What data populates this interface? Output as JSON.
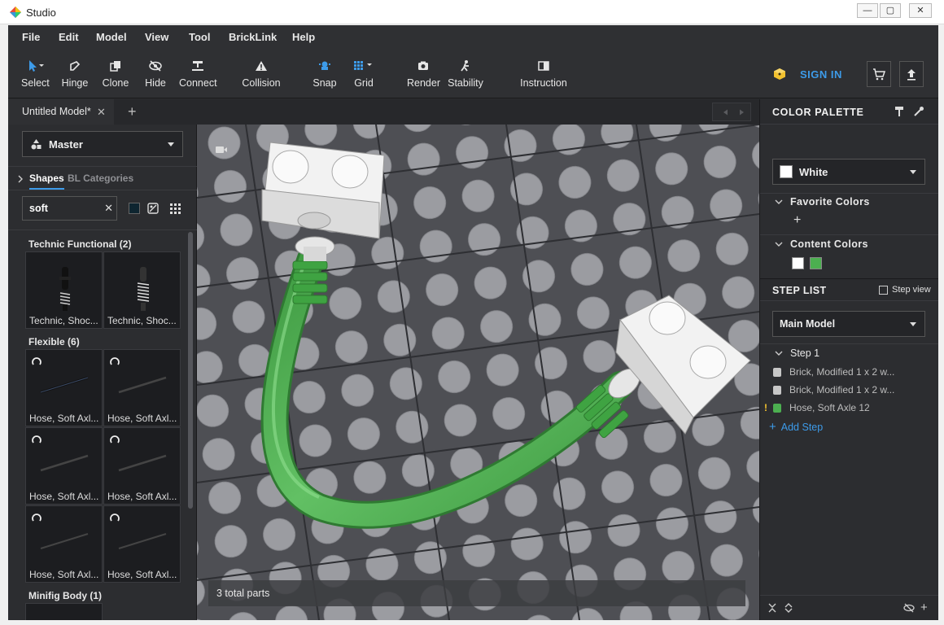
{
  "window": {
    "title": "Studio",
    "minimize": "—",
    "maximize": "▢",
    "close": "✕"
  },
  "menu": [
    "File",
    "Edit",
    "Model",
    "View",
    "Tool",
    "BrickLink",
    "Help"
  ],
  "toolbar": {
    "tools": [
      {
        "label": "Select",
        "icon": "arrow-cursor-icon"
      },
      {
        "label": "Hinge",
        "icon": "hinge-icon"
      },
      {
        "label": "Clone",
        "icon": "clone-icon"
      },
      {
        "label": "Hide",
        "icon": "eye-off-icon"
      },
      {
        "label": "Connect",
        "icon": "connect-icon"
      },
      {
        "label": "Collision",
        "icon": "warning-triangle-icon"
      },
      {
        "label": "Snap",
        "icon": "snap-icon"
      },
      {
        "label": "Grid",
        "icon": "grid-icon"
      },
      {
        "label": "Render",
        "icon": "camera-icon"
      },
      {
        "label": "Stability",
        "icon": "stability-icon"
      },
      {
        "label": "Instruction",
        "icon": "book-icon"
      }
    ],
    "sign_in": "SIGN IN"
  },
  "tabs": {
    "active": "Untitled Model*",
    "close": "✕",
    "add": "+"
  },
  "left_panel": {
    "palette_dropdown": "Master",
    "shape_tabs": [
      "Shapes",
      "BL Categories"
    ],
    "search_value": "soft",
    "search_clear": "✕",
    "groups": [
      {
        "title": "Technic Functional (2)",
        "items": [
          "Technic, Shoc...",
          "Technic, Shoc..."
        ]
      },
      {
        "title": "Flexible (6)",
        "items": [
          "Hose, Soft Axl...",
          "Hose, Soft Axl...",
          "Hose, Soft Axl...",
          "Hose, Soft Axl...",
          "Hose, Soft Axl...",
          "Hose, Soft Axl..."
        ]
      },
      {
        "title": "Minifig Body (1)",
        "items": []
      }
    ]
  },
  "viewport": {
    "status": "3 total parts"
  },
  "right_panel": {
    "color_palette_title": "COLOR PALETTE",
    "selected_color": "White",
    "favorite_colors": "Favorite Colors",
    "favorite_add": "+",
    "content_colors": "Content Colors",
    "content_swatches": [
      "#ffffff",
      "#4caf50"
    ],
    "step_list_title": "STEP LIST",
    "step_view": "Step view",
    "model_dropdown": "Main Model",
    "step": "Step 1",
    "parts": [
      "Brick, Modified 1 x 2 w...",
      "Brick, Modified 1 x 2 w...",
      "Hose, Soft Axle 12"
    ],
    "warning_mark": "!",
    "add_step": "Add Step",
    "add_step_plus": "+"
  },
  "colors": {
    "accent": "#3d9be9",
    "signin_yellow": "#f2c12e",
    "hose_green": "#4caf50"
  }
}
